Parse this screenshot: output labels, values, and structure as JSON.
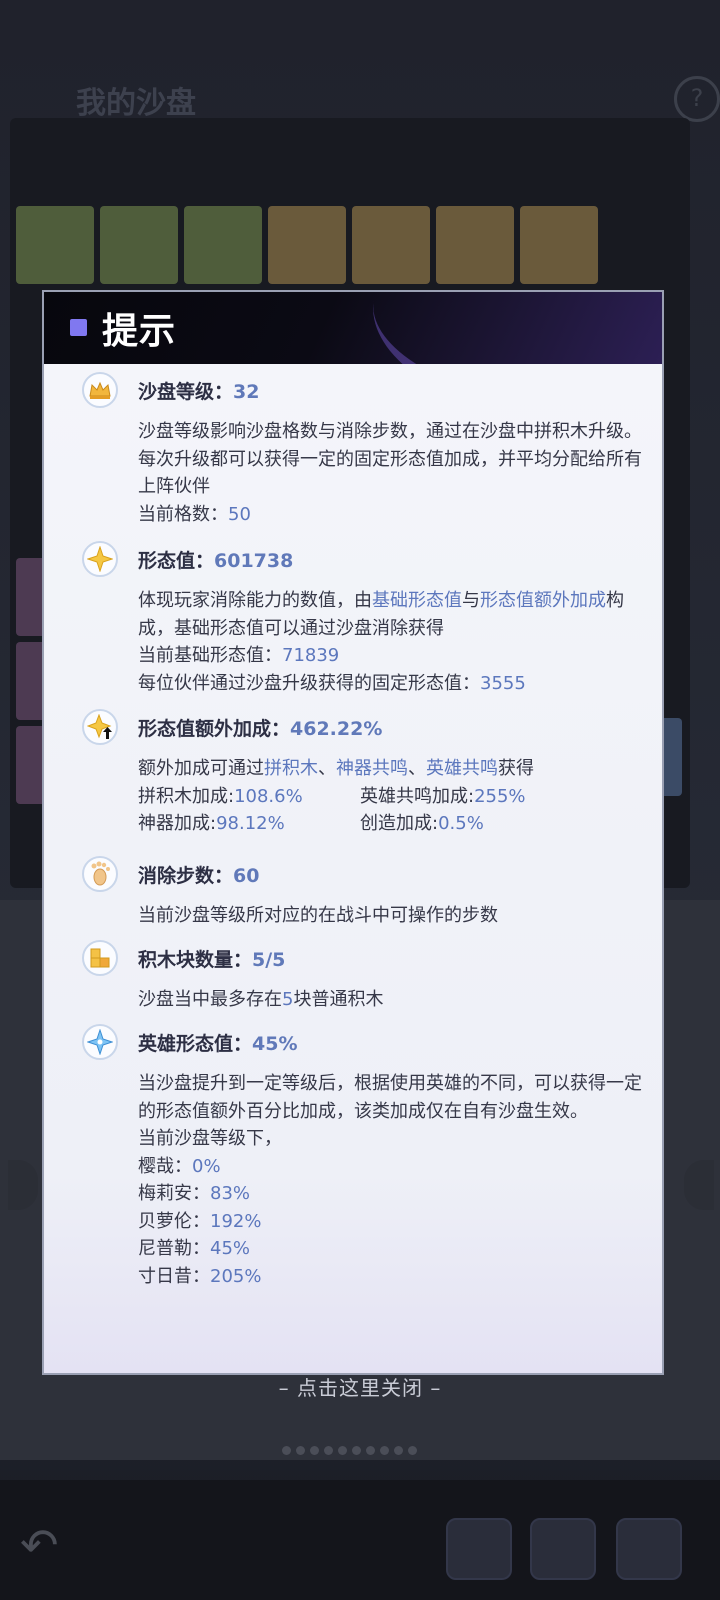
{
  "background": {
    "title": "我的沙盘",
    "help_icon": "question-icon"
  },
  "dialog": {
    "title": "提示",
    "sections": [
      {
        "icon": "crown-icon",
        "label": "沙盘等级：",
        "value": "32",
        "desc": "沙盘等级影响沙盘格数与消除步数，通过在沙盘中拼积木升级。每次升级都可以获得一定的固定形态值加成，并平均分配给所有上阵伙伴",
        "current_label": "当前格数：",
        "current_value": "50"
      },
      {
        "icon": "sparkle-icon",
        "label": "形态值：",
        "value": "601738",
        "desc_part1": "体现玩家消除能力的数值，由",
        "link1": "基础形态值",
        "desc_and": "与",
        "link2": "形态值额外加成",
        "desc_part2": "构成，基础形态值可以通过沙盘消除获得",
        "base_label": "当前基础形态值：",
        "base_value": "71839",
        "partner_label": "每位伙伴通过沙盘升级获得的固定形态值：",
        "partner_value": "3555"
      },
      {
        "icon": "sparkle-up-icon",
        "label": "形态值额外加成：",
        "value": "462.22%",
        "desc_part1": "额外加成可通过",
        "link1": "拼积木",
        "sep1": "、",
        "link2": "神器共鸣",
        "sep2": "、",
        "link3": "英雄共鸣",
        "desc_part2": "获得",
        "bonus_block_label": "拼积木加成:",
        "bonus_block_value": "108.6%",
        "bonus_hero_label": "英雄共鸣加成:",
        "bonus_hero_value": "255%",
        "bonus_artifact_label": "神器加成:",
        "bonus_artifact_value": "98.12%",
        "bonus_create_label": "创造加成:",
        "bonus_create_value": "0.5%"
      },
      {
        "icon": "footprint-icon",
        "label": "消除步数：",
        "value": "60",
        "desc": "当前沙盘等级所对应的在战斗中可操作的步数"
      },
      {
        "icon": "blocks-icon",
        "label": "积木块数量：",
        "value": "5/5",
        "desc_part1": "沙盘当中最多存在",
        "desc_num": "5",
        "desc_part2": "块普通积木"
      },
      {
        "icon": "star-icon",
        "label": "英雄形态值：",
        "value": "45%",
        "desc": "当沙盘提升到一定等级后，根据使用英雄的不同，可以获得一定的形态值额外百分比加成，该类加成仅在自有沙盘生效。",
        "current_label": "当前沙盘等级下，",
        "heroes": [
          {
            "name": "樱哉：",
            "value": "0%"
          },
          {
            "name": "梅莉安：",
            "value": "83%"
          },
          {
            "name": "贝萝伦：",
            "value": "192%"
          },
          {
            "name": "尼普勒：",
            "value": "45%"
          },
          {
            "name": "寸日昔：",
            "value": "205%"
          }
        ]
      }
    ]
  },
  "close_hint": "– 点击这里关闭 –"
}
